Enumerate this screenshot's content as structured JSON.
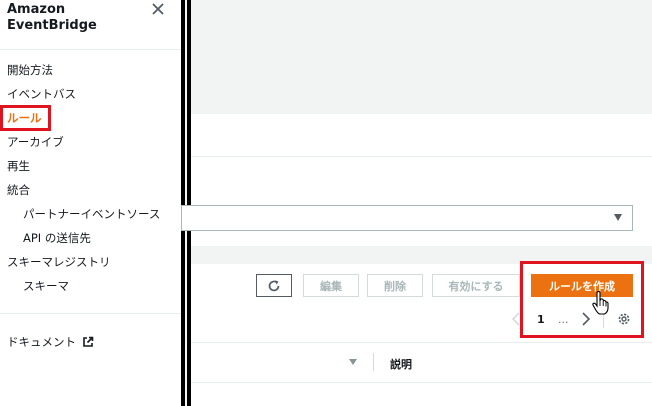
{
  "sidebar": {
    "title_line1": "Amazon",
    "title_line2": "EventBridge",
    "items": [
      {
        "label": "開始方法"
      },
      {
        "label": "イベントバス"
      },
      {
        "label": "ルール"
      },
      {
        "label": "アーカイブ"
      },
      {
        "label": "再生"
      },
      {
        "label": "統合"
      },
      {
        "label": "パートナーイベントソース"
      },
      {
        "label": "API の送信先"
      },
      {
        "label": "スキーマレジストリ"
      },
      {
        "label": "スキーマ"
      }
    ],
    "docs_label": "ドキュメント"
  },
  "toolbar": {
    "edit_label": "編集",
    "delete_label": "削除",
    "enable_label": "有効にする",
    "create_rule_label": "ルールを作成"
  },
  "pagination": {
    "current_page": "1",
    "ellipsis": "..."
  },
  "table": {
    "description_header": "説明"
  },
  "colors": {
    "accent": "#ec7211",
    "highlight": "#e0141e"
  },
  "icons": {
    "close": "close-icon",
    "refresh": "refresh-icon",
    "external": "external-link-icon",
    "settings": "gear-icon",
    "cursor": "hand-pointer-icon"
  }
}
